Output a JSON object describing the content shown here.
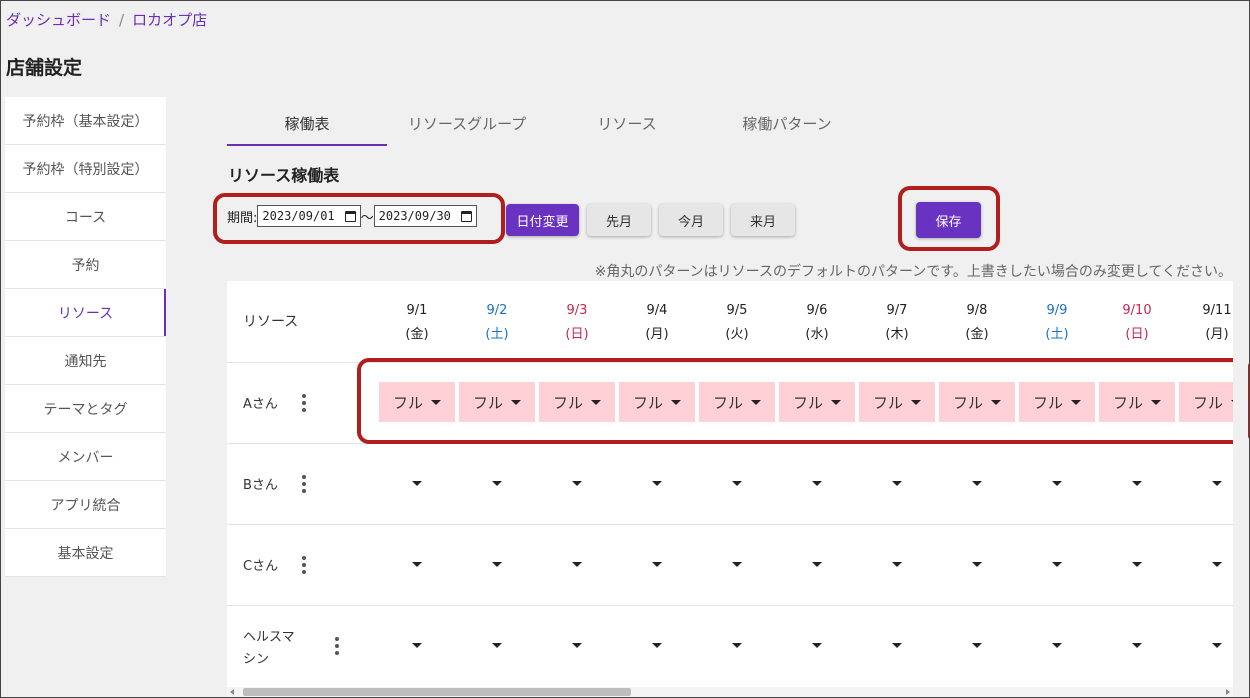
{
  "breadcrumb": {
    "home": "ダッシュボード",
    "separator": "/",
    "store": "ロカオプ店"
  },
  "page_title": "店舗設定",
  "sidebar": {
    "items": [
      {
        "label": "予約枠（基本設定）",
        "active": false
      },
      {
        "label": "予約枠（特別設定）",
        "active": false
      },
      {
        "label": "コース",
        "active": false
      },
      {
        "label": "予約",
        "active": false
      },
      {
        "label": "リソース",
        "active": true
      },
      {
        "label": "通知先",
        "active": false
      },
      {
        "label": "テーマとタグ",
        "active": false
      },
      {
        "label": "メンバー",
        "active": false
      },
      {
        "label": "アプリ統合",
        "active": false
      },
      {
        "label": "基本設定",
        "active": false
      }
    ]
  },
  "tabs": [
    {
      "label": "稼働表",
      "active": true
    },
    {
      "label": "リソースグループ",
      "active": false
    },
    {
      "label": "リソース",
      "active": false
    },
    {
      "label": "稼働パターン",
      "active": false
    }
  ],
  "section_title": "リソース稼働表",
  "period": {
    "label": "期間:",
    "start": "2023/09/01",
    "separator": "～",
    "end": "2023/09/30"
  },
  "buttons": {
    "change_date": "日付変更",
    "prev_month": "先月",
    "this_month": "今月",
    "next_month": "来月",
    "save": "保存"
  },
  "note": "※角丸のパターンはリソースのデフォルトのパターンです。上書きしたい場合のみ変更してください。",
  "table": {
    "resource_header": "リソース",
    "days": [
      {
        "date": "9/1",
        "weekday": "(金)",
        "type": "weekday"
      },
      {
        "date": "9/2",
        "weekday": "(土)",
        "type": "sat"
      },
      {
        "date": "9/3",
        "weekday": "(日)",
        "type": "sun"
      },
      {
        "date": "9/4",
        "weekday": "(月)",
        "type": "weekday"
      },
      {
        "date": "9/5",
        "weekday": "(火)",
        "type": "weekday"
      },
      {
        "date": "9/6",
        "weekday": "(水)",
        "type": "weekday"
      },
      {
        "date": "9/7",
        "weekday": "(木)",
        "type": "weekday"
      },
      {
        "date": "9/8",
        "weekday": "(金)",
        "type": "weekday"
      },
      {
        "date": "9/9",
        "weekday": "(土)",
        "type": "sat"
      },
      {
        "date": "9/10",
        "weekday": "(日)",
        "type": "sun"
      },
      {
        "date": "9/11",
        "weekday": "(月)",
        "type": "weekday"
      }
    ],
    "rows": [
      {
        "name": "Aさん",
        "cell_value": "フル",
        "filled": true
      },
      {
        "name": "Bさん",
        "cell_value": "",
        "filled": false
      },
      {
        "name": "Cさん",
        "cell_value": "",
        "filled": false
      },
      {
        "name": "ヘルスマシン",
        "cell_value": "",
        "filled": false
      }
    ]
  },
  "colors": {
    "accent": "#6a32c0",
    "highlight": "#b01e1e",
    "pattern_full": "#ffd0d6",
    "saturday": "#1a6fc4",
    "sunday": "#c8264a"
  }
}
